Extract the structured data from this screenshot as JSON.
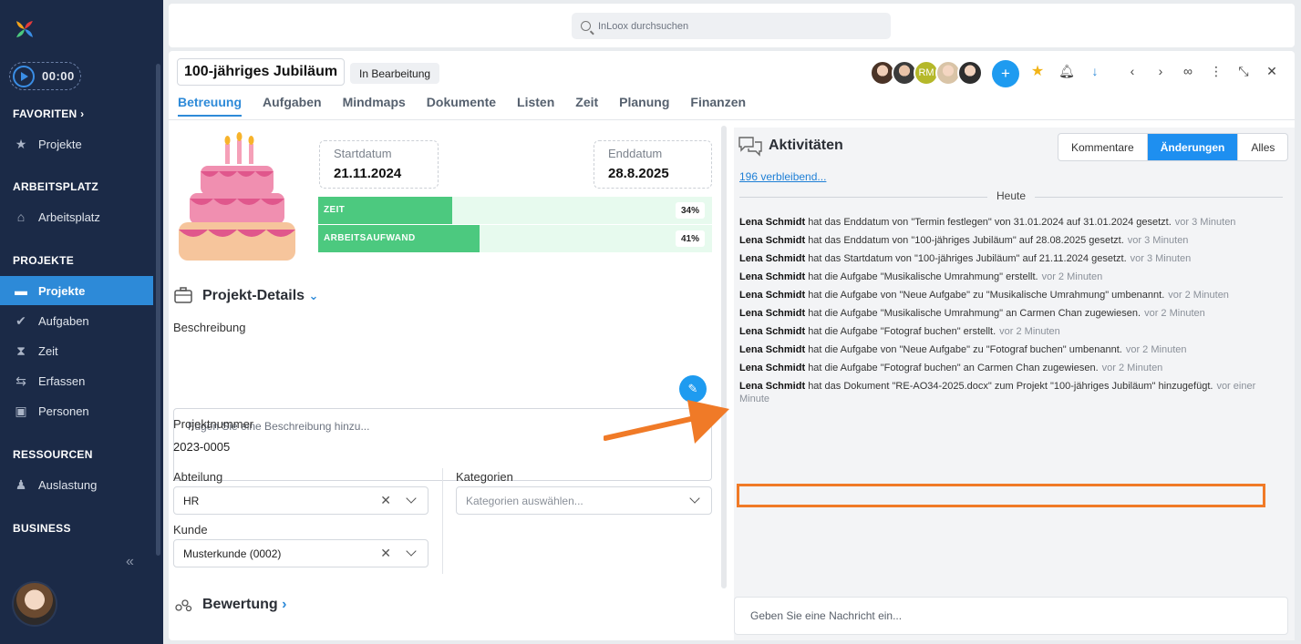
{
  "sidebar": {
    "timer": "00:00",
    "favorites_head": "FAVORITEN",
    "fav_item": "Projekte",
    "workplace_head": "ARBEITSPLATZ",
    "workplace_item": "Arbeitsplatz",
    "projects_head": "PROJEKTE",
    "items": [
      "Projekte",
      "Aufgaben",
      "Zeit",
      "Erfassen",
      "Personen"
    ],
    "resources_head": "RESSOURCEN",
    "resources_item": "Auslastung",
    "business_head": "BUSINESS"
  },
  "search": {
    "placeholder": "InLoox durchsuchen"
  },
  "project": {
    "title": "100-jähriges Jubiläum",
    "status": "In Bearbeitung",
    "tabs": [
      "Betreuung",
      "Aufgaben",
      "Mindmaps",
      "Dokumente",
      "Listen",
      "Zeit",
      "Planung",
      "Finanzen"
    ],
    "avatar_initials": "RM",
    "add_label": "+"
  },
  "details": {
    "start_label": "Startdatum",
    "start_value": "21.11.2024",
    "end_label": "Enddatum",
    "end_value": "28.8.2025",
    "bars": [
      {
        "name": "ZEIT",
        "percent_label": "34%",
        "progress": 0.34
      },
      {
        "name": "ARBEITSAUFWAND",
        "percent_label": "41%",
        "progress": 0.41
      }
    ],
    "section_title": "Projekt-Details",
    "description_label": "Beschreibung",
    "description_placeholder": "Fügen Sie eine Beschreibung hinzu...",
    "number_label": "Projektnummer",
    "number_value": "2023-0005",
    "department_label": "Abteilung",
    "department_value": "HR",
    "categories_label": "Kategorien",
    "categories_placeholder": "Kategorien auswählen...",
    "customer_label": "Kunde",
    "customer_value": "Musterkunde (0002)",
    "rating_title": "Bewertung"
  },
  "activities": {
    "title": "Aktivitäten",
    "seg": [
      "Kommentare",
      "Änderungen",
      "Alles"
    ],
    "remaining": "196 verbleibend...",
    "today": "Heute",
    "feed": [
      {
        "user": "Lena Schmidt",
        "text": "hat das Enddatum von \"Termin festlegen\" von 31.01.2024 auf 31.01.2024 gesetzt.",
        "time": "vor 3 Minuten"
      },
      {
        "user": "Lena Schmidt",
        "text": "hat das Enddatum von \"100-jähriges Jubiläum\" auf 28.08.2025 gesetzt.",
        "time": "vor 3 Minuten"
      },
      {
        "user": "Lena Schmidt",
        "text": "hat das Startdatum von \"100-jähriges Jubiläum\" auf 21.11.2024 gesetzt.",
        "time": "vor 3 Minuten"
      },
      {
        "user": "Lena Schmidt",
        "text": "hat die Aufgabe \"Musikalische Umrahmung\" erstellt.",
        "time": "vor 2 Minuten"
      },
      {
        "user": "Lena Schmidt",
        "text": "hat die Aufgabe von \"Neue Aufgabe\" zu \"Musikalische Umrahmung\" umbenannt.",
        "time": "vor 2 Minuten"
      },
      {
        "user": "Lena Schmidt",
        "text": "hat die Aufgabe \"Musikalische Umrahmung\" an Carmen Chan zugewiesen.",
        "time": "vor 2 Minuten"
      },
      {
        "user": "Lena Schmidt",
        "text": "hat die Aufgabe \"Fotograf buchen\" erstellt.",
        "time": "vor 2 Minuten"
      },
      {
        "user": "Lena Schmidt",
        "text": "hat die Aufgabe von \"Neue Aufgabe\" zu \"Fotograf buchen\" umbenannt.",
        "time": "vor 2 Minuten"
      },
      {
        "user": "Lena Schmidt",
        "text": "hat die Aufgabe \"Fotograf buchen\" an Carmen Chan zugewiesen.",
        "time": "vor 2 Minuten"
      },
      {
        "user": "Lena Schmidt",
        "text": "hat das Dokument \"RE-AO34-2025.docx\" zum Projekt \"100-jähriges Jubiläum\" hinzugefügt.",
        "time": "vor einer Minute"
      }
    ],
    "message_placeholder": "Geben Sie eine Nachricht ein..."
  },
  "colors": {
    "accent": "#2d8ad8",
    "sidebar": "#1b2a47",
    "progress": "#4cc97f",
    "highlight": "#f07a27"
  }
}
